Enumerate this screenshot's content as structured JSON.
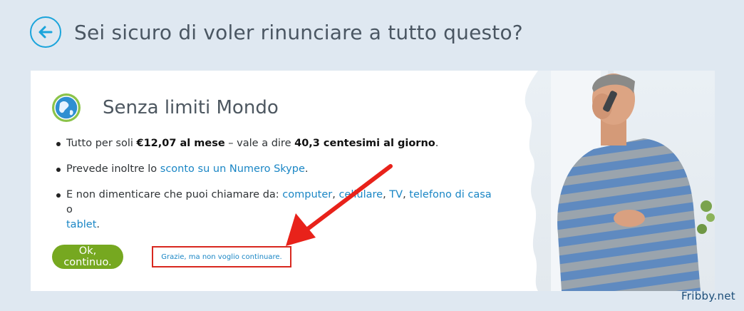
{
  "header": {
    "back_icon": "arrow-left-icon",
    "title": "Sei sicuro di voler rinunciare a tutto questo?"
  },
  "plan": {
    "icon": "globe-icon",
    "title": "Senza limiti Mondo",
    "features": [
      {
        "part1": "Tutto per soli ",
        "price": "€12,07 al mese",
        "part2": " – vale a dire ",
        "daily": "40,3 centesimi al giorno",
        "part3": "."
      },
      {
        "part1": "Prevede inoltre lo ",
        "link": "sconto su un Numero Skype",
        "part2": "."
      },
      {
        "part1": "E non dimenticare che puoi chiamare da: ",
        "link_computer": "computer",
        "sep1": ", ",
        "link_cellulare": "cellulare",
        "sep2": ", ",
        "link_tv": "TV",
        "sep3": ", ",
        "link_telefono": "telefono di casa",
        "sep4": " o ",
        "link_tablet": "tablet",
        "end": "."
      }
    ]
  },
  "actions": {
    "ok_label": "Ok, continuo.",
    "decline_label": "Grazie, ma non voglio continuare."
  },
  "annotation": {
    "arrow_color": "#e8221a",
    "highlight_color": "#d8281f"
  },
  "watermark": "Fribby.net",
  "colors": {
    "accent_blue": "#1aa4db",
    "link_blue": "#1a86c5",
    "ok_green": "#76a820",
    "page_bg": "#dfe8f1"
  }
}
